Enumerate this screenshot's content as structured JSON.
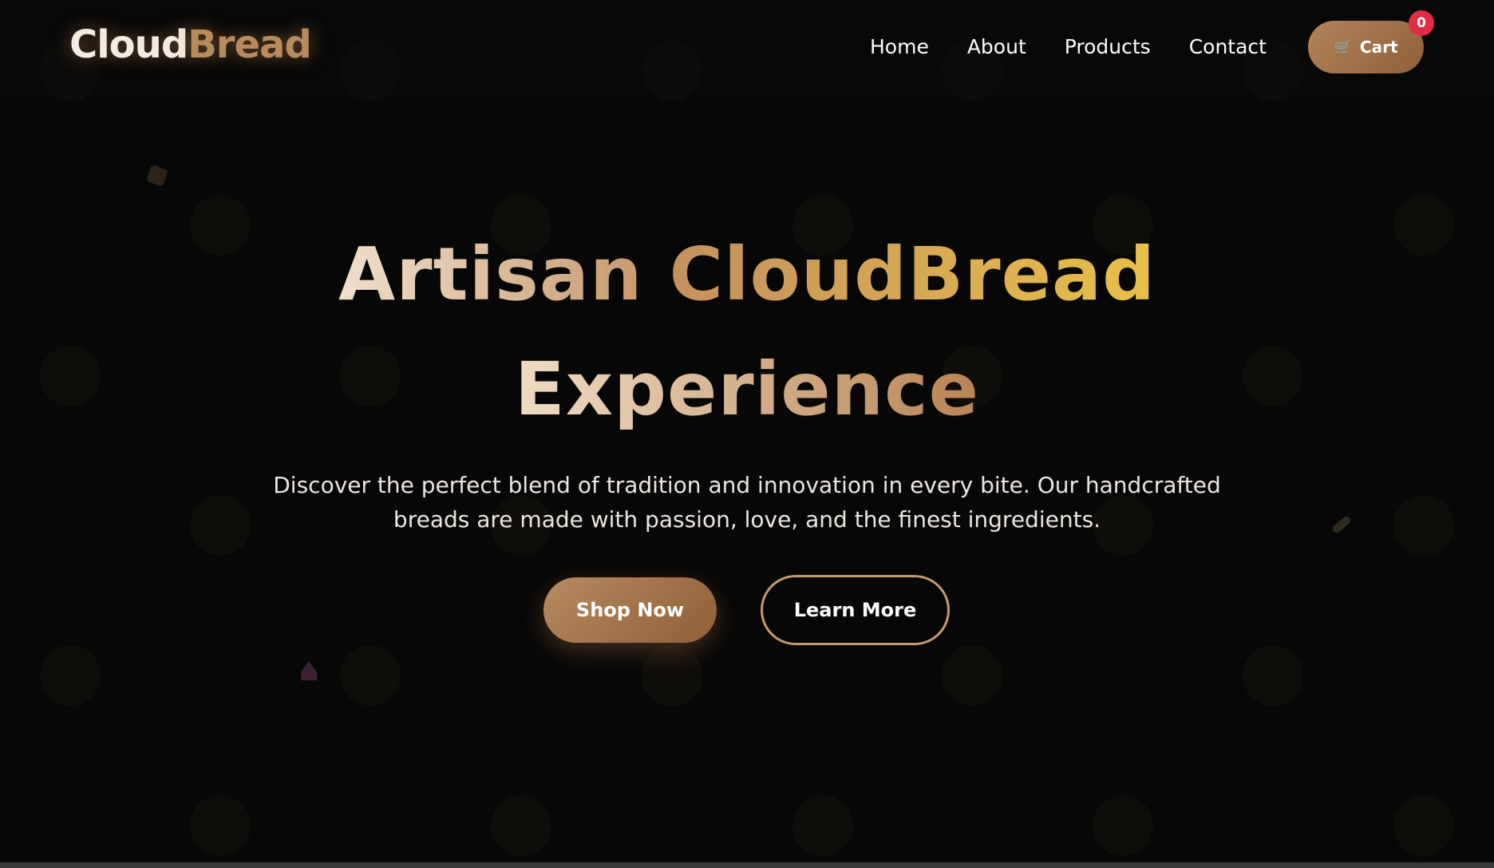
{
  "brand": {
    "part1": "Cloud",
    "part2": "Bread"
  },
  "nav": {
    "items": [
      {
        "label": "Home"
      },
      {
        "label": "About"
      },
      {
        "label": "Products"
      },
      {
        "label": "Contact"
      }
    ]
  },
  "cart": {
    "icon": "cart-icon",
    "label": "Cart",
    "count": "0"
  },
  "hero": {
    "headline_word1": "Artisan",
    "headline_word2": "CloudBread",
    "headline_line2": "Experience",
    "subtitle": "Discover the perfect blend of tradition and innovation in every bite. Our handcrafted breads are made with passion, love, and the finest ingredients.",
    "primary_button": "Shop Now",
    "secondary_button": "Learn More"
  },
  "colors": {
    "background": "#070707",
    "accent": "#b4845a",
    "gold": "#e8c04a",
    "badge": "#e12e44"
  }
}
